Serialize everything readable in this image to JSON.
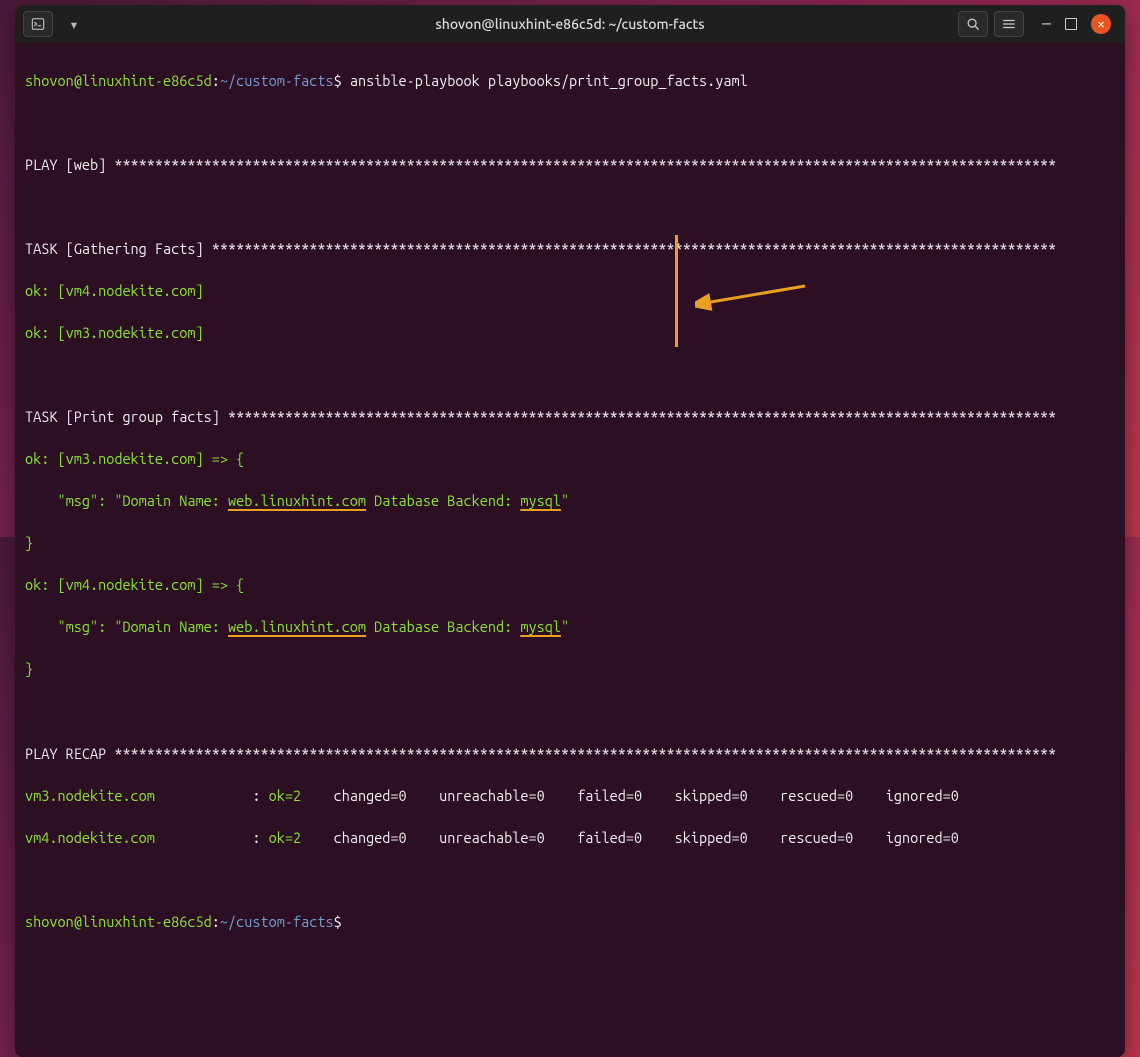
{
  "titlebar": {
    "title": "shovon@linuxhint-e86c5d: ~/custom-facts"
  },
  "prompt": {
    "user_host": "shovon@linuxhint-e86c5d",
    "colon": ":",
    "path": "~/custom-facts",
    "dollar": "$"
  },
  "command": " ansible-playbook playbooks/print_group_facts.yaml",
  "play_web": "PLAY [web] ********************************************************************************************************************",
  "task_gather": "TASK [Gathering Facts] ********************************************************************************************************",
  "gather_ok": [
    "ok: [vm4.nodekite.com]",
    "ok: [vm3.nodekite.com]"
  ],
  "task_print": "TASK [Print group facts] ******************************************************************************************************",
  "result1": {
    "head": "ok: [vm3.nodekite.com] => {",
    "msg_pre": "    \"msg\": \"Domain Name: ",
    "domain": "web.linuxhint.com",
    "msg_mid": " Database Backend: ",
    "backend": "mysql",
    "msg_post": "\"",
    "close": "}"
  },
  "result2": {
    "head": "ok: [vm4.nodekite.com] => {",
    "msg_pre": "    \"msg\": \"Domain Name: ",
    "domain": "web.linuxhint.com",
    "msg_mid": " Database Backend: ",
    "backend": "mysql",
    "msg_post": "\"",
    "close": "}"
  },
  "recap_header": "PLAY RECAP ********************************************************************************************************************",
  "recap": [
    {
      "host": "vm3.nodekite.com",
      "pad": "           ",
      "colon": " : ",
      "ok": "ok=2",
      "rest": "    changed=0    unreachable=0    failed=0    skipped=0    rescued=0    ignored=0"
    },
    {
      "host": "vm4.nodekite.com",
      "pad": "           ",
      "colon": " : ",
      "ok": "ok=2",
      "rest": "    changed=0    unreachable=0    failed=0    skipped=0    rescued=0    ignored=0"
    }
  ]
}
